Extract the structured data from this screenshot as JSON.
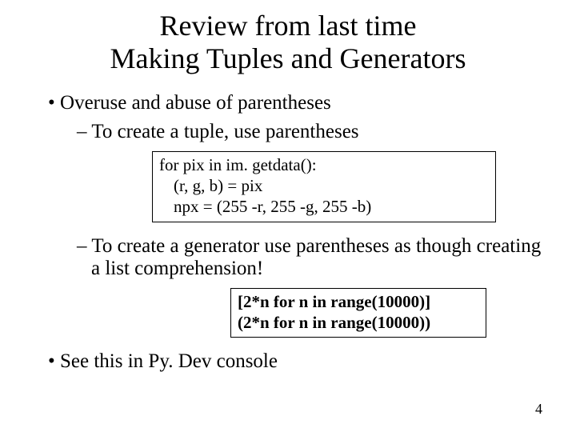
{
  "title_line1": "Review from last time",
  "title_line2": "Making Tuples and Generators",
  "bullets": {
    "b1": "Overuse and abuse of parentheses",
    "s1": "To create a tuple, use parentheses",
    "s2": "To create a generator use parentheses as though creating a list comprehension!",
    "b2": "See this in Py. Dev console"
  },
  "code1": {
    "l1": "for pix in im. getdata():",
    "l2": "(r, g, b) = pix",
    "l3": "npx = (255 -r, 255 -g, 255 -b)"
  },
  "code2": {
    "l1": "[2*n for n in range(10000)]",
    "l2": "(2*n for n in range(10000))"
  },
  "page_number": "4"
}
